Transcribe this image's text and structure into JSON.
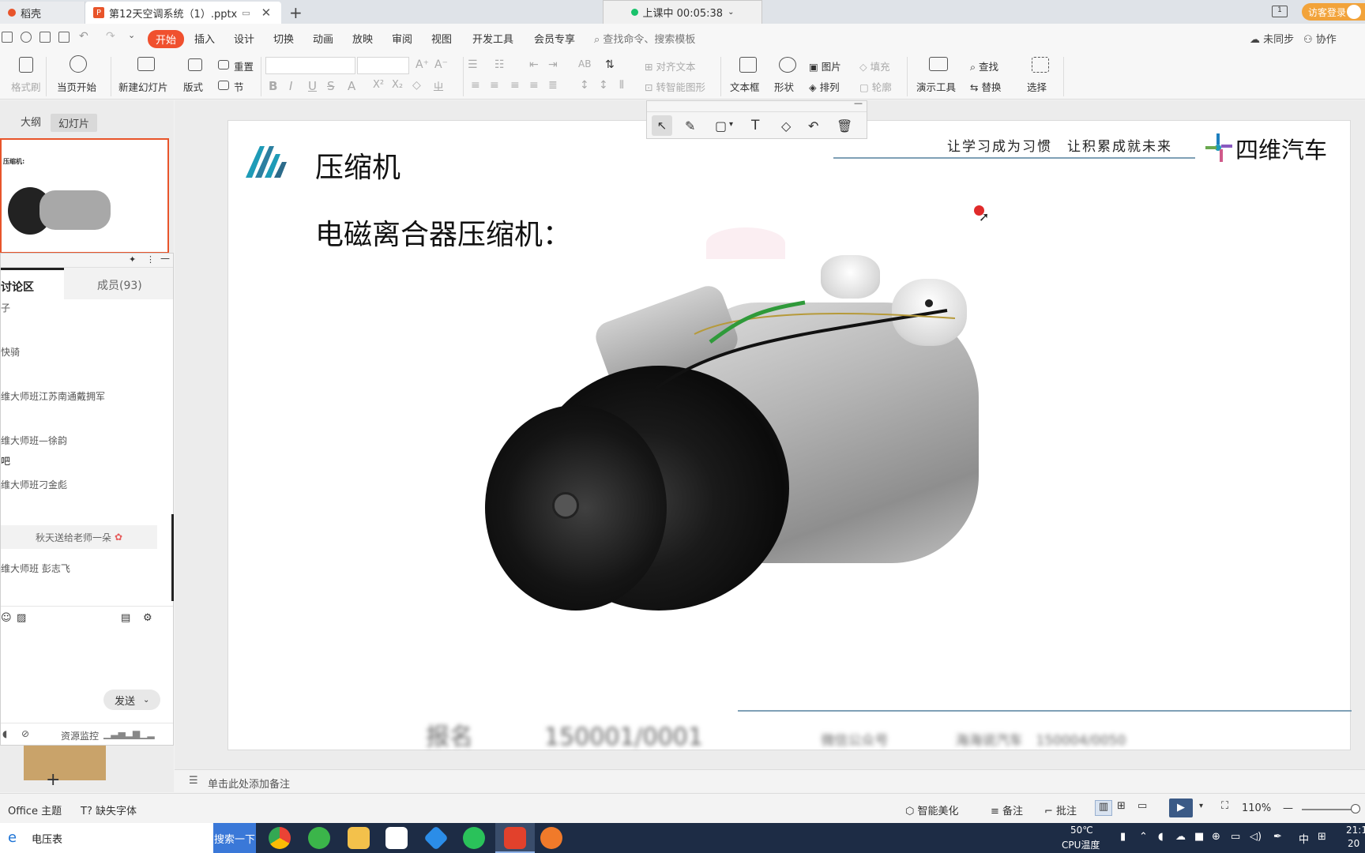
{
  "tabs": {
    "home_tab": "稻壳",
    "doc_tab": "第12天空调系统（1）.pptx",
    "new_tab": "+"
  },
  "timer": {
    "label": "上课中 00:05:38"
  },
  "guest_login": "访客登录",
  "menu": {
    "items": [
      "开始",
      "插入",
      "设计",
      "切换",
      "动画",
      "放映",
      "审阅",
      "视图",
      "开发工具",
      "会员专享"
    ],
    "search_placeholder": "查找命令、搜索模板",
    "unsynced": "未同步",
    "collaborate": "协作"
  },
  "ribbon": {
    "format_painter": "格式刷",
    "reset": "重置",
    "play_from_current": "当页开始",
    "new_slide": "新建幻灯片",
    "layout": "版式",
    "section": "节",
    "align_text": "对齐文本",
    "to_smartart": "转智能图形",
    "textbox": "文本框",
    "shape": "形状",
    "picture": "图片",
    "arrange": "排列",
    "fill": "填充",
    "outline": "轮廓",
    "presenter_tools": "演示工具",
    "find": "查找",
    "replace": "替换",
    "select": "选择"
  },
  "left_pane": {
    "outline_tab": "大纲",
    "slides_tab": "幻灯片",
    "thumb_title": "压缩机:"
  },
  "chat": {
    "tab_discussion": "讨论区",
    "tab_members": "成员(93)",
    "messages": [
      "子",
      "快骑",
      "维大师班江苏南通戴拥军",
      "维大师班—徐韵",
      "吧",
      "维大师班刁金彪"
    ],
    "flower_msg": "秋天送给老师一朵",
    "last_msg": "维大师班 彭志飞",
    "send": "发送",
    "resource_monitor": "资源监控"
  },
  "slide": {
    "title": "压缩机",
    "subtitle": "电磁离合器压缩机：",
    "slogan": "让学习成为习惯　让积累成就未来",
    "brand": "四维汽车",
    "footer_left": "报名　　　150001/0001",
    "footer_right": "微信公众号　　　　　海海说汽车　150004/0050"
  },
  "notes": {
    "placeholder": "单击此处添加备注"
  },
  "status": {
    "theme": "Office 主题",
    "missing_font": "缺失字体",
    "smart_beautify": "智能美化",
    "notes": "备注",
    "comments": "批注",
    "zoom": "110%"
  },
  "taskbar": {
    "search_value": "电压表",
    "search_button": "搜索一下",
    "temp": "50℃",
    "temp_label": "CPU温度",
    "ime": "中",
    "time": "21:1",
    "date": "20"
  },
  "colors": {
    "accent": "#f0502e",
    "taskbar": "#1d2c45",
    "guest": "#f2a33a"
  }
}
